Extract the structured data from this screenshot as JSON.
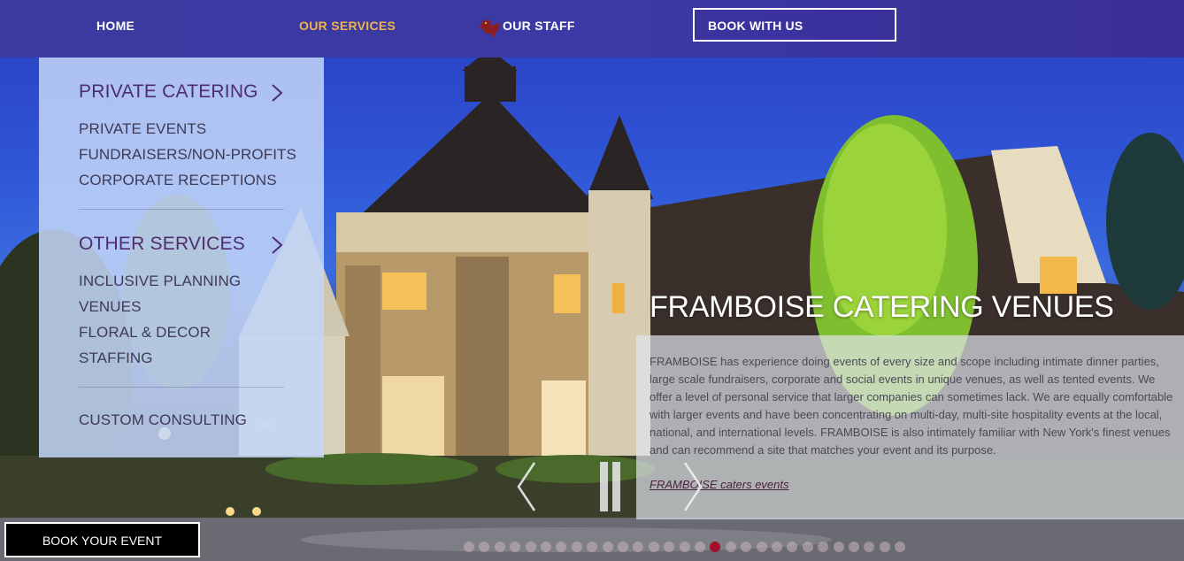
{
  "nav": {
    "home": "HOME",
    "services": "OUR SERVICES",
    "staff": "OUR STAFF",
    "book": "BOOK WITH US"
  },
  "dropdown": {
    "private_heading": "PRIVATE CATERING",
    "private_items": [
      "PRIVATE EVENTS",
      "FUNDRAISERS/NON-PROFITS",
      "CORPORATE RECEPTIONS"
    ],
    "other_heading": "OTHER SERVICES",
    "other_items": [
      "INCLUSIVE PLANNING",
      "VENUES",
      "FLORAL & DECOR",
      "STAFFING"
    ],
    "consulting": "CUSTOM CONSULTING"
  },
  "hero": {
    "title": "FRAMBOISE CATERING VENUES",
    "body": "FRAMBOISE has experience doing events of every size and scope including intimate dinner parties, large scale fundraisers, corporate and social events in unique venues, as well as tented events. We offer a level of personal service that larger companies can sometimes lack. We are equally comfortable with larger events and have been concentrating on multi-day, multi-site hospitality events at the local, national, and international levels. FRAMBOISE is also intimately familiar with New York's finest venues and can recommend a site that matches your event and its purpose.",
    "link": "FRAMBOISE caters events"
  },
  "slider": {
    "total_slides": 29,
    "active_slide": 17
  },
  "book_event": "BOOK YOUR EVENT",
  "colors": {
    "nav_bg": "#3a3aa0",
    "nav_active": "#f3b447",
    "dropdown_heading": "#4d2d6e",
    "active_dot": "#a3102b"
  }
}
